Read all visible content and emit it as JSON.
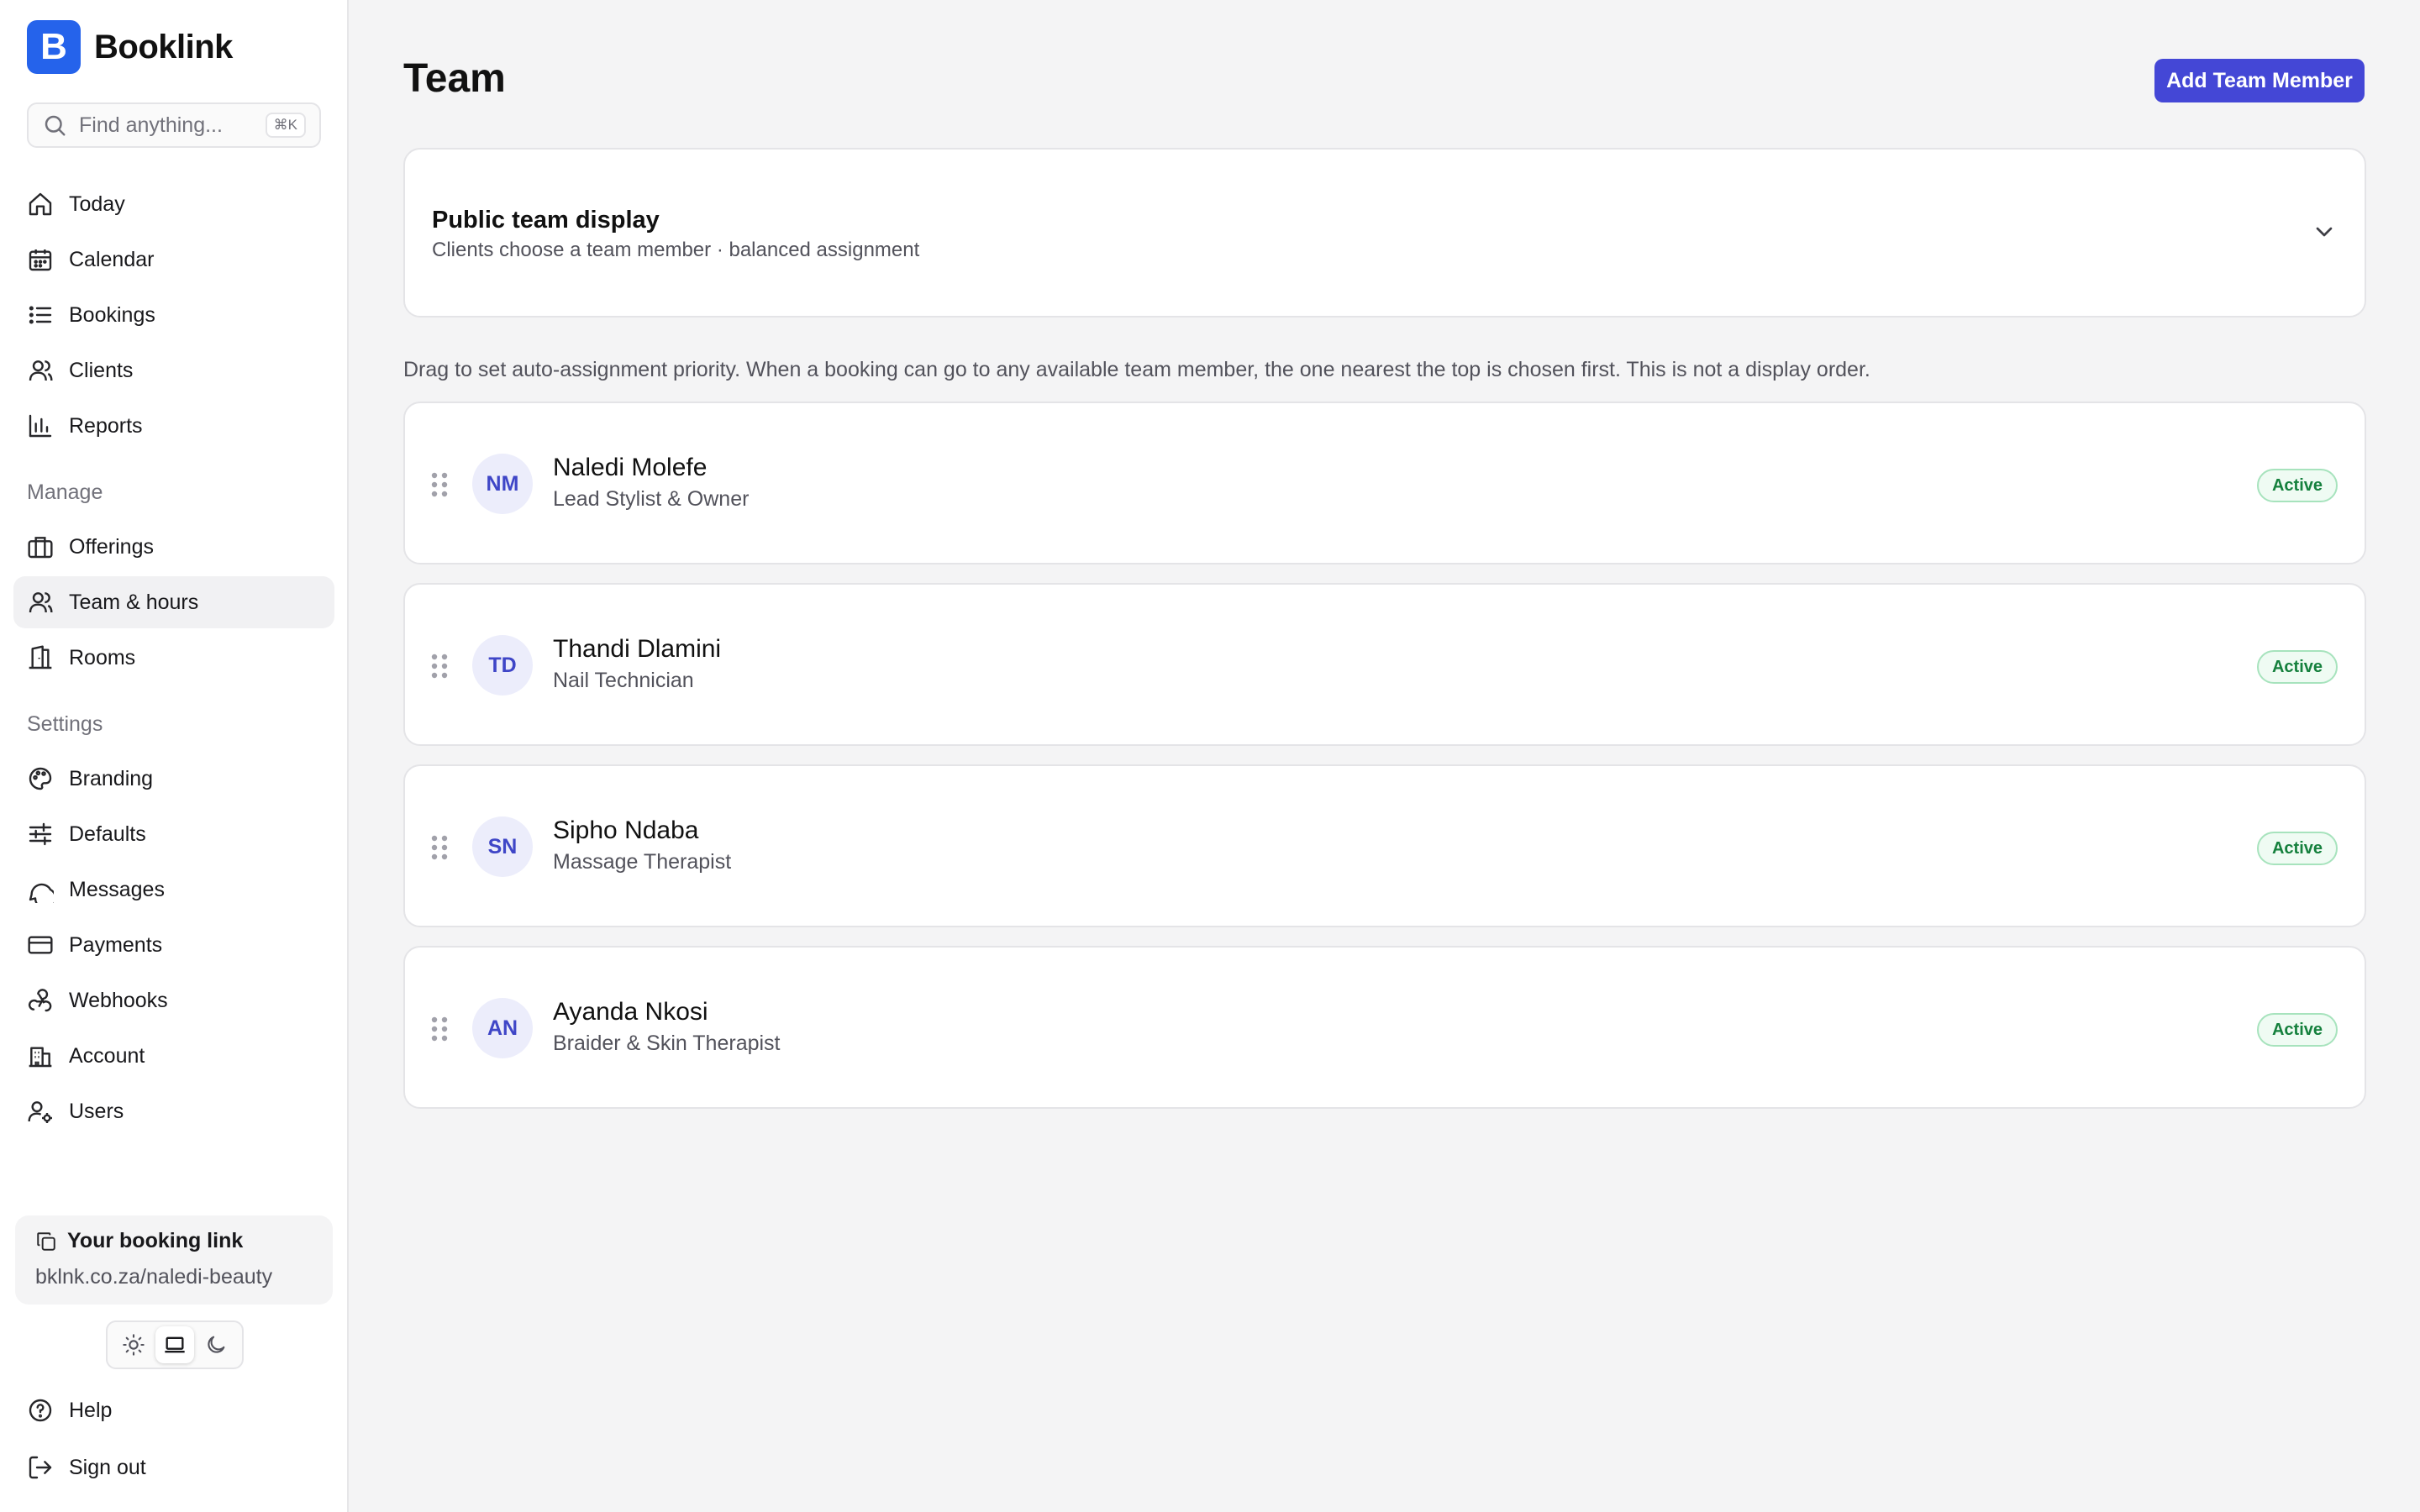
{
  "app": {
    "logo_letter": "B",
    "name": "Booklink"
  },
  "search": {
    "placeholder": "Find anything...",
    "shortcut": "⌘K"
  },
  "nav_main": [
    {
      "label": "Today",
      "icon": "home-icon"
    },
    {
      "label": "Calendar",
      "icon": "calendar-icon"
    },
    {
      "label": "Bookings",
      "icon": "list-icon"
    },
    {
      "label": "Clients",
      "icon": "user-icon"
    },
    {
      "label": "Reports",
      "icon": "bar-chart-icon"
    }
  ],
  "manage": {
    "heading": "Manage",
    "items": [
      {
        "label": "Offerings",
        "icon": "briefcase-icon"
      },
      {
        "label": "Team & hours",
        "icon": "users-icon",
        "active": true
      },
      {
        "label": "Rooms",
        "icon": "door-icon"
      }
    ]
  },
  "settings": {
    "heading": "Settings",
    "items": [
      {
        "label": "Branding",
        "icon": "palette-icon"
      },
      {
        "label": "Defaults",
        "icon": "sliders-icon"
      },
      {
        "label": "Messages",
        "icon": "message-circle-icon"
      },
      {
        "label": "Payments",
        "icon": "credit-card-icon"
      },
      {
        "label": "Webhooks",
        "icon": "webhook-icon"
      },
      {
        "label": "Account",
        "icon": "building-icon"
      },
      {
        "label": "Users",
        "icon": "user-cog-icon"
      }
    ]
  },
  "booking_link": {
    "title": "Your booking link",
    "url": "bklnk.co.za/naledi-beauty"
  },
  "theme": {
    "selected": "system"
  },
  "footer_nav": [
    {
      "label": "Help",
      "icon": "help-circle-icon"
    },
    {
      "label": "Sign out",
      "icon": "log-out-icon"
    }
  ],
  "page": {
    "title": "Team",
    "add_button": "Add Team Member"
  },
  "panel": {
    "title": "Public team display",
    "subtitle": "Clients choose a team member · balanced assignment"
  },
  "hint": "Drag to set auto-assignment priority. When a booking can go to any available team member, the one nearest the top is chosen first. This is not a display order.",
  "members": [
    {
      "initials": "NM",
      "name": "Naledi Molefe",
      "role": "Lead Stylist & Owner",
      "status": "Active"
    },
    {
      "initials": "TD",
      "name": "Thandi Dlamini",
      "role": "Nail Technician",
      "status": "Active"
    },
    {
      "initials": "SN",
      "name": "Sipho Ndaba",
      "role": "Massage Therapist",
      "status": "Active"
    },
    {
      "initials": "AN",
      "name": "Ayanda Nkosi",
      "role": "Braider & Skin Therapist",
      "status": "Active"
    }
  ],
  "colors": {
    "brand": "#2563eb",
    "primary_button": "#4447d6",
    "avatar_bg": "#ecedfb",
    "avatar_text": "#3f46c7",
    "status_active": "#15803d"
  }
}
